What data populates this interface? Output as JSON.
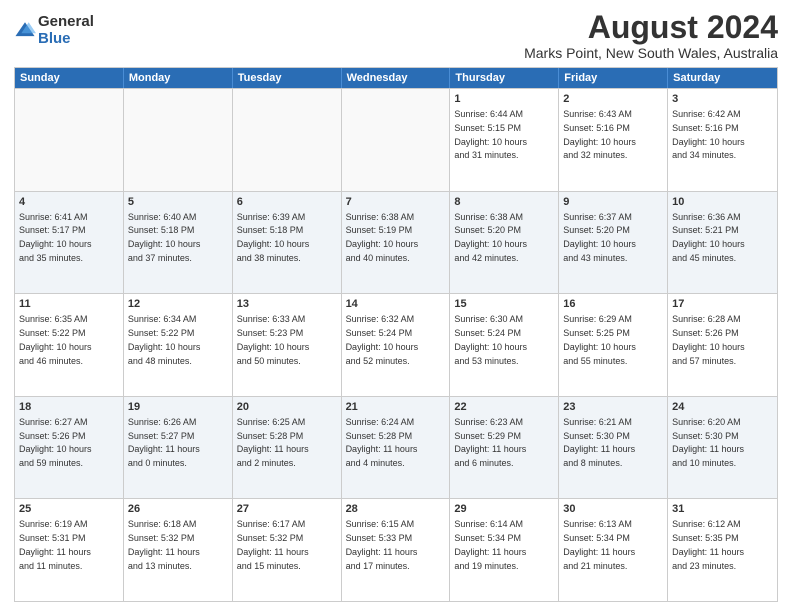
{
  "logo": {
    "general": "General",
    "blue": "Blue"
  },
  "title": "August 2024",
  "subtitle": "Marks Point, New South Wales, Australia",
  "header_days": [
    "Sunday",
    "Monday",
    "Tuesday",
    "Wednesday",
    "Thursday",
    "Friday",
    "Saturday"
  ],
  "weeks": [
    [
      {
        "day": "",
        "info": ""
      },
      {
        "day": "",
        "info": ""
      },
      {
        "day": "",
        "info": ""
      },
      {
        "day": "",
        "info": ""
      },
      {
        "day": "1",
        "info": "Sunrise: 6:44 AM\nSunset: 5:15 PM\nDaylight: 10 hours\nand 31 minutes."
      },
      {
        "day": "2",
        "info": "Sunrise: 6:43 AM\nSunset: 5:16 PM\nDaylight: 10 hours\nand 32 minutes."
      },
      {
        "day": "3",
        "info": "Sunrise: 6:42 AM\nSunset: 5:16 PM\nDaylight: 10 hours\nand 34 minutes."
      }
    ],
    [
      {
        "day": "4",
        "info": "Sunrise: 6:41 AM\nSunset: 5:17 PM\nDaylight: 10 hours\nand 35 minutes."
      },
      {
        "day": "5",
        "info": "Sunrise: 6:40 AM\nSunset: 5:18 PM\nDaylight: 10 hours\nand 37 minutes."
      },
      {
        "day": "6",
        "info": "Sunrise: 6:39 AM\nSunset: 5:18 PM\nDaylight: 10 hours\nand 38 minutes."
      },
      {
        "day": "7",
        "info": "Sunrise: 6:38 AM\nSunset: 5:19 PM\nDaylight: 10 hours\nand 40 minutes."
      },
      {
        "day": "8",
        "info": "Sunrise: 6:38 AM\nSunset: 5:20 PM\nDaylight: 10 hours\nand 42 minutes."
      },
      {
        "day": "9",
        "info": "Sunrise: 6:37 AM\nSunset: 5:20 PM\nDaylight: 10 hours\nand 43 minutes."
      },
      {
        "day": "10",
        "info": "Sunrise: 6:36 AM\nSunset: 5:21 PM\nDaylight: 10 hours\nand 45 minutes."
      }
    ],
    [
      {
        "day": "11",
        "info": "Sunrise: 6:35 AM\nSunset: 5:22 PM\nDaylight: 10 hours\nand 46 minutes."
      },
      {
        "day": "12",
        "info": "Sunrise: 6:34 AM\nSunset: 5:22 PM\nDaylight: 10 hours\nand 48 minutes."
      },
      {
        "day": "13",
        "info": "Sunrise: 6:33 AM\nSunset: 5:23 PM\nDaylight: 10 hours\nand 50 minutes."
      },
      {
        "day": "14",
        "info": "Sunrise: 6:32 AM\nSunset: 5:24 PM\nDaylight: 10 hours\nand 52 minutes."
      },
      {
        "day": "15",
        "info": "Sunrise: 6:30 AM\nSunset: 5:24 PM\nDaylight: 10 hours\nand 53 minutes."
      },
      {
        "day": "16",
        "info": "Sunrise: 6:29 AM\nSunset: 5:25 PM\nDaylight: 10 hours\nand 55 minutes."
      },
      {
        "day": "17",
        "info": "Sunrise: 6:28 AM\nSunset: 5:26 PM\nDaylight: 10 hours\nand 57 minutes."
      }
    ],
    [
      {
        "day": "18",
        "info": "Sunrise: 6:27 AM\nSunset: 5:26 PM\nDaylight: 10 hours\nand 59 minutes."
      },
      {
        "day": "19",
        "info": "Sunrise: 6:26 AM\nSunset: 5:27 PM\nDaylight: 11 hours\nand 0 minutes."
      },
      {
        "day": "20",
        "info": "Sunrise: 6:25 AM\nSunset: 5:28 PM\nDaylight: 11 hours\nand 2 minutes."
      },
      {
        "day": "21",
        "info": "Sunrise: 6:24 AM\nSunset: 5:28 PM\nDaylight: 11 hours\nand 4 minutes."
      },
      {
        "day": "22",
        "info": "Sunrise: 6:23 AM\nSunset: 5:29 PM\nDaylight: 11 hours\nand 6 minutes."
      },
      {
        "day": "23",
        "info": "Sunrise: 6:21 AM\nSunset: 5:30 PM\nDaylight: 11 hours\nand 8 minutes."
      },
      {
        "day": "24",
        "info": "Sunrise: 6:20 AM\nSunset: 5:30 PM\nDaylight: 11 hours\nand 10 minutes."
      }
    ],
    [
      {
        "day": "25",
        "info": "Sunrise: 6:19 AM\nSunset: 5:31 PM\nDaylight: 11 hours\nand 11 minutes."
      },
      {
        "day": "26",
        "info": "Sunrise: 6:18 AM\nSunset: 5:32 PM\nDaylight: 11 hours\nand 13 minutes."
      },
      {
        "day": "27",
        "info": "Sunrise: 6:17 AM\nSunset: 5:32 PM\nDaylight: 11 hours\nand 15 minutes."
      },
      {
        "day": "28",
        "info": "Sunrise: 6:15 AM\nSunset: 5:33 PM\nDaylight: 11 hours\nand 17 minutes."
      },
      {
        "day": "29",
        "info": "Sunrise: 6:14 AM\nSunset: 5:34 PM\nDaylight: 11 hours\nand 19 minutes."
      },
      {
        "day": "30",
        "info": "Sunrise: 6:13 AM\nSunset: 5:34 PM\nDaylight: 11 hours\nand 21 minutes."
      },
      {
        "day": "31",
        "info": "Sunrise: 6:12 AM\nSunset: 5:35 PM\nDaylight: 11 hours\nand 23 minutes."
      }
    ]
  ]
}
